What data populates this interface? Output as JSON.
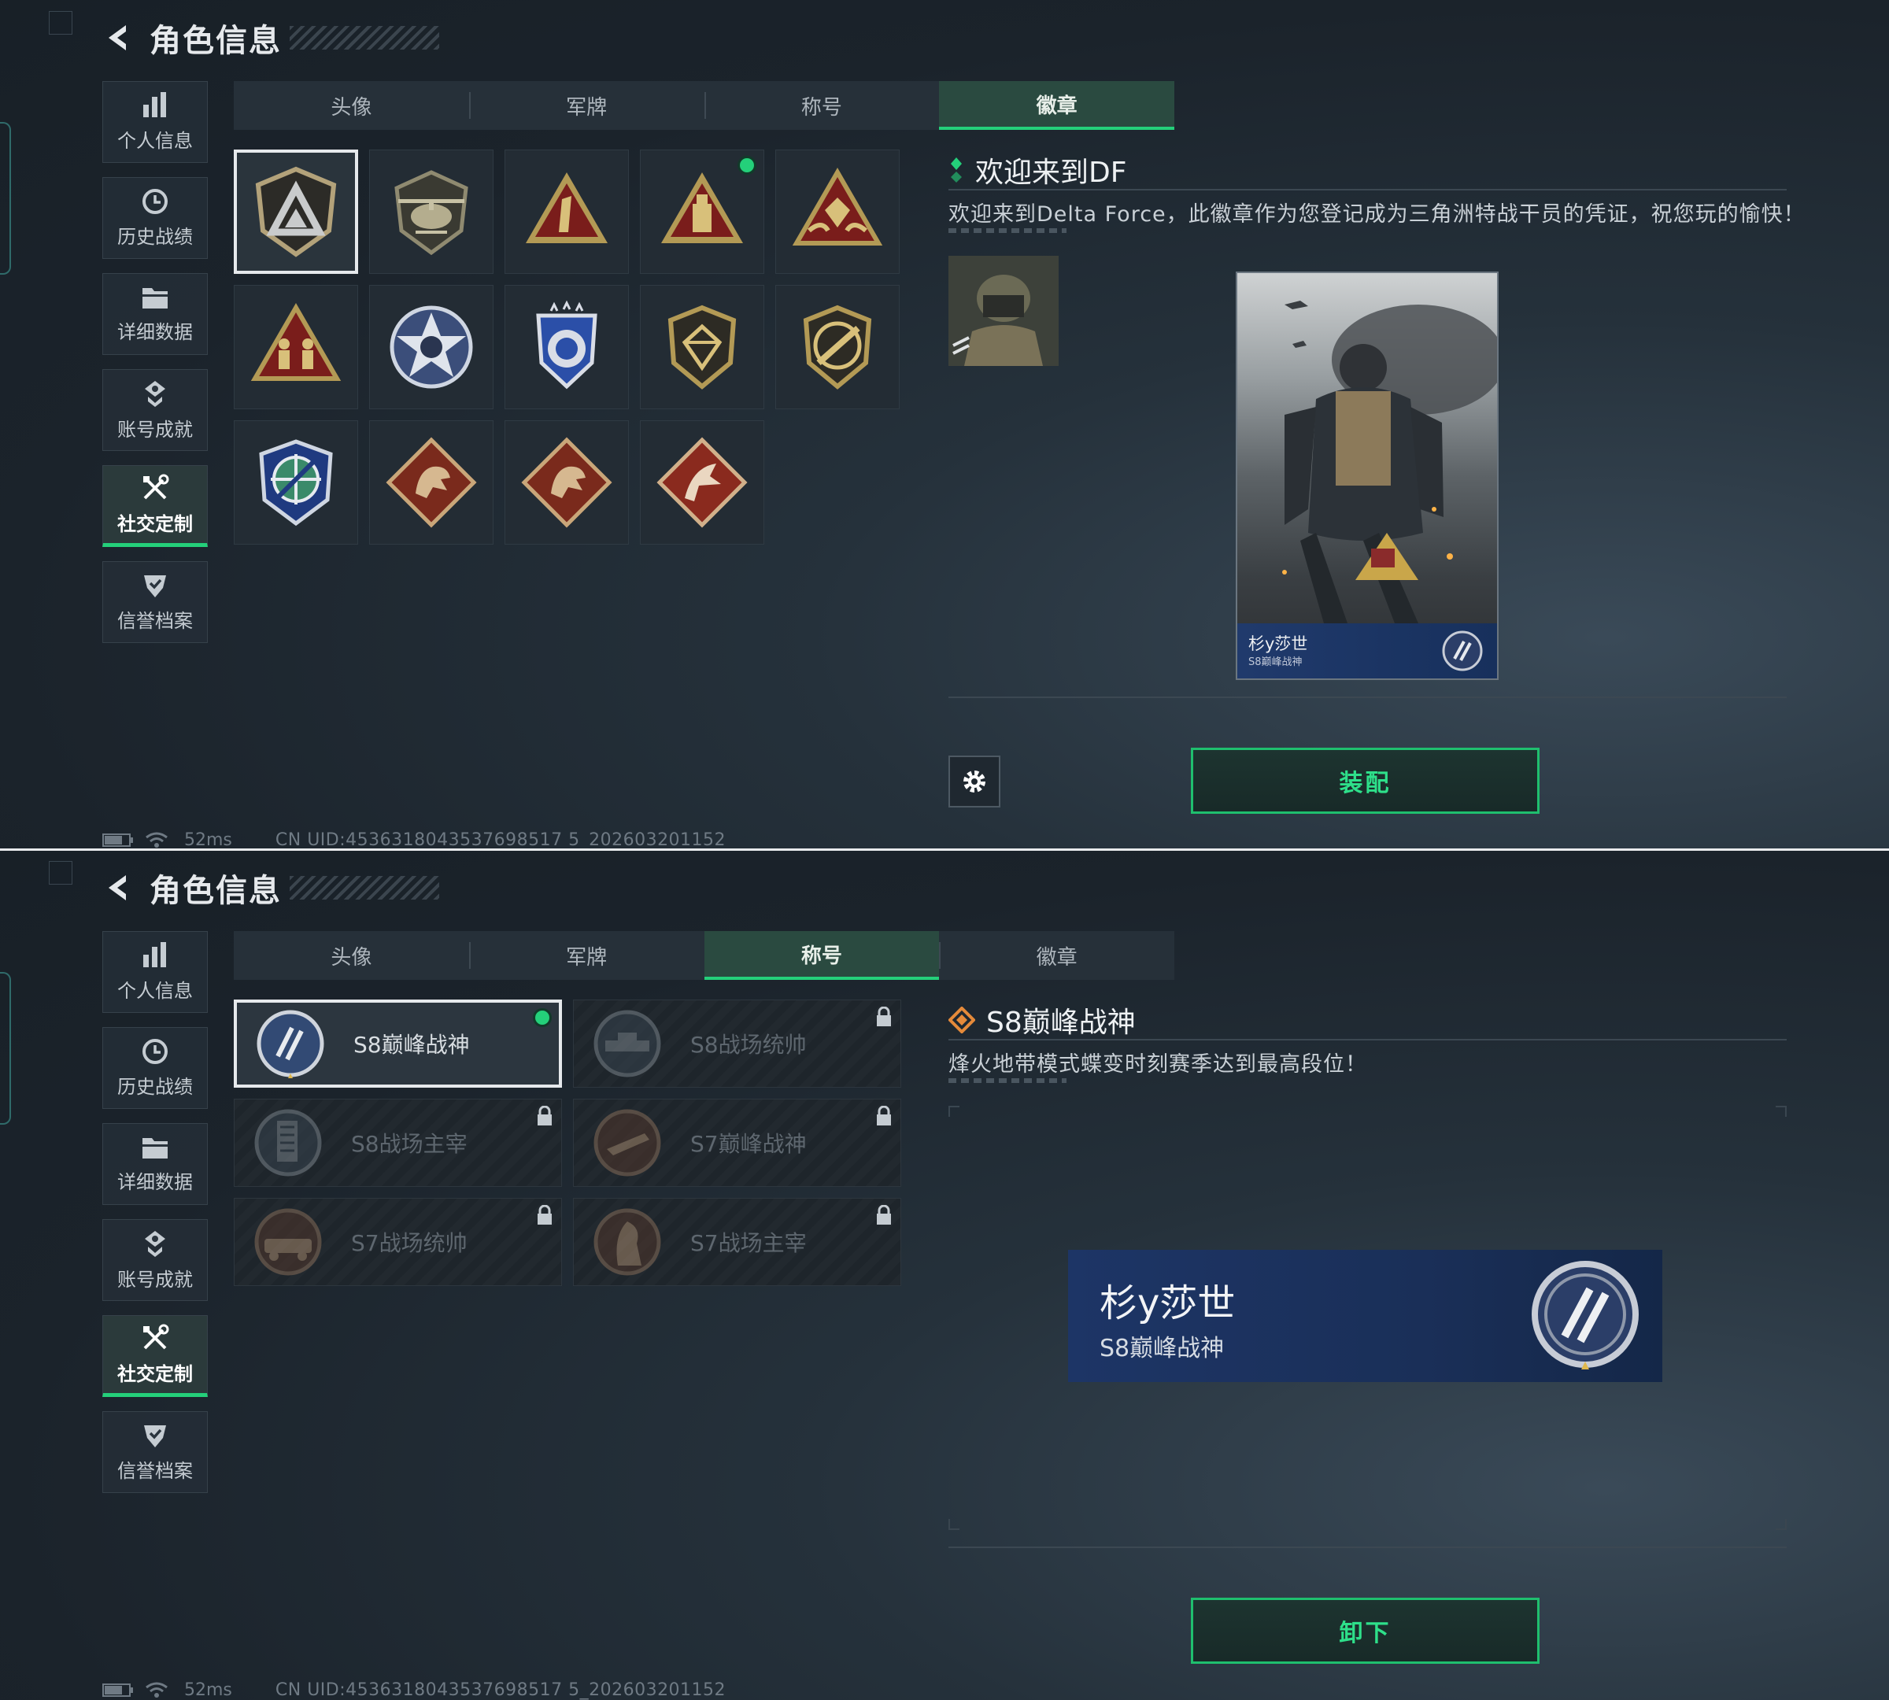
{
  "colors": {
    "accent_green": "#24d07a",
    "equipped_dot": "#24d07a",
    "nameplate_blue": "#1d3566"
  },
  "screen1": {
    "header": {
      "title": "角色信息"
    },
    "sidebar": {
      "items": [
        {
          "label": "个人信息",
          "icon": "bar-chart-icon"
        },
        {
          "label": "历史战绩",
          "icon": "clock-icon"
        },
        {
          "label": "详细数据",
          "icon": "folder-icon"
        },
        {
          "label": "账号成就",
          "icon": "achievement-icon"
        },
        {
          "label": "社交定制",
          "icon": "tools-icon",
          "active": true
        },
        {
          "label": "信誉档案",
          "icon": "shield-check-icon"
        }
      ]
    },
    "tabs": [
      {
        "label": "头像"
      },
      {
        "label": "军牌"
      },
      {
        "label": "称号"
      },
      {
        "label": "徽章",
        "active": true
      }
    ],
    "badges": [
      {
        "name": "delta-shield-badge",
        "selected": true
      },
      {
        "name": "helicopter-badge"
      },
      {
        "name": "number-one-triangle-badge"
      },
      {
        "name": "usb-triangle-badge",
        "equipped": true
      },
      {
        "name": "diamond-hands-badge"
      },
      {
        "name": "soldiers-triangle-badge"
      },
      {
        "name": "skull-star-badge"
      },
      {
        "name": "blue-police-badge"
      },
      {
        "name": "gem-shield-badge"
      },
      {
        "name": "rifle-shield-badge"
      },
      {
        "name": "crosshair-shield-badge"
      },
      {
        "name": "dragon-diamond-badge"
      },
      {
        "name": "dragon-diamond-badge-2"
      },
      {
        "name": "creature-diamond-badge"
      }
    ],
    "detail": {
      "title": "欢迎来到DF",
      "description": "欢迎来到Delta Force，此徽章作为您登记成为三角洲特战干员的凭证，祝您玩的愉快！"
    },
    "card": {
      "name": "杉y莎世",
      "subtitle": "S8巅峰战神"
    },
    "action_button": "装配",
    "status": {
      "ping": "52ms",
      "uid": "CN UID:4536318043537698517 5_202603201152"
    }
  },
  "screen2": {
    "header": {
      "title": "角色信息"
    },
    "sidebar": {
      "items": [
        {
          "label": "个人信息",
          "icon": "bar-chart-icon"
        },
        {
          "label": "历史战绩",
          "icon": "clock-icon"
        },
        {
          "label": "详细数据",
          "icon": "folder-icon"
        },
        {
          "label": "账号成就",
          "icon": "achievement-icon"
        },
        {
          "label": "社交定制",
          "icon": "tools-icon",
          "active": true
        },
        {
          "label": "信誉档案",
          "icon": "shield-check-icon"
        }
      ]
    },
    "tabs": [
      {
        "label": "头像"
      },
      {
        "label": "军牌"
      },
      {
        "label": "称号",
        "active": true
      },
      {
        "label": "徽章"
      }
    ],
    "titles": [
      {
        "label": "S8巅峰战神",
        "selected": true,
        "equipped": true
      },
      {
        "label": "S8战场统帅",
        "locked": true
      },
      {
        "label": "S8战场主宰",
        "locked": true
      },
      {
        "label": "S7巅峰战神",
        "locked": true
      },
      {
        "label": "S7战场统帅",
        "locked": true
      },
      {
        "label": "S7战场主宰",
        "locked": true
      }
    ],
    "detail": {
      "title": "S8巅峰战神",
      "description": "烽火地带模式蝶变时刻赛季达到最高段位！"
    },
    "nameplate": {
      "name": "杉y莎世",
      "subtitle": "S8巅峰战神"
    },
    "action_button": "卸下",
    "status": {
      "ping": "52ms",
      "uid": "CN UID:4536318043537698517 5_202603201152"
    }
  }
}
